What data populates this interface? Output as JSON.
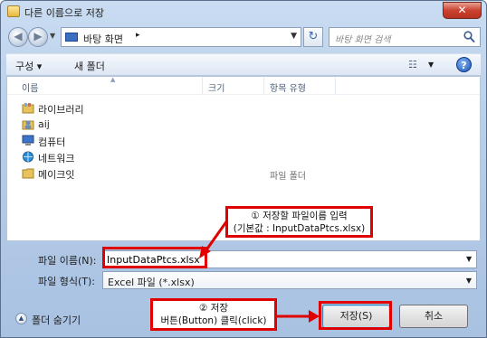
{
  "window": {
    "title": "다른 이름으로 저장",
    "close_glyph": "✕"
  },
  "address": {
    "location": "바탕 화면",
    "separator": "▸",
    "search_placeholder": "바탕 화면 검색"
  },
  "toolbar": {
    "organize": "구성 ▾",
    "new_folder": "새 폴더",
    "views_glyph": "☷",
    "help": "?"
  },
  "columns": {
    "name": "이름",
    "size": "크기",
    "type": "항목 유형"
  },
  "items": [
    {
      "name": "라이브러리",
      "type": "",
      "icon": "library-icon"
    },
    {
      "name": "aij",
      "type": "",
      "icon": "user-folder-icon"
    },
    {
      "name": "컴퓨터",
      "type": "",
      "icon": "computer-icon"
    },
    {
      "name": "네트워크",
      "type": "",
      "icon": "network-icon"
    },
    {
      "name": "메이크잇",
      "type": "파일 폴더",
      "icon": "folder-icon"
    }
  ],
  "form": {
    "filename_label": "파일 이름(N):",
    "filename_value": "InputDataPtcs.xlsx",
    "filetype_label": "파일 형식(T):",
    "filetype_value": "Excel 파일 (*.xlsx)"
  },
  "footer": {
    "hide_folders": "폴더 숨기기",
    "save": "저장(S)",
    "cancel": "취소"
  },
  "annotations": {
    "step1_line1": "① 저장할 파일이름 입력",
    "step1_line2": "(기본값 : InputDataPtcs.xlsx)",
    "step2_line1": "② 저장",
    "step2_line2": "버튼(Button) 클릭(click)"
  },
  "colors": {
    "annotation": "#e00000",
    "folder": "#e6b83c"
  }
}
